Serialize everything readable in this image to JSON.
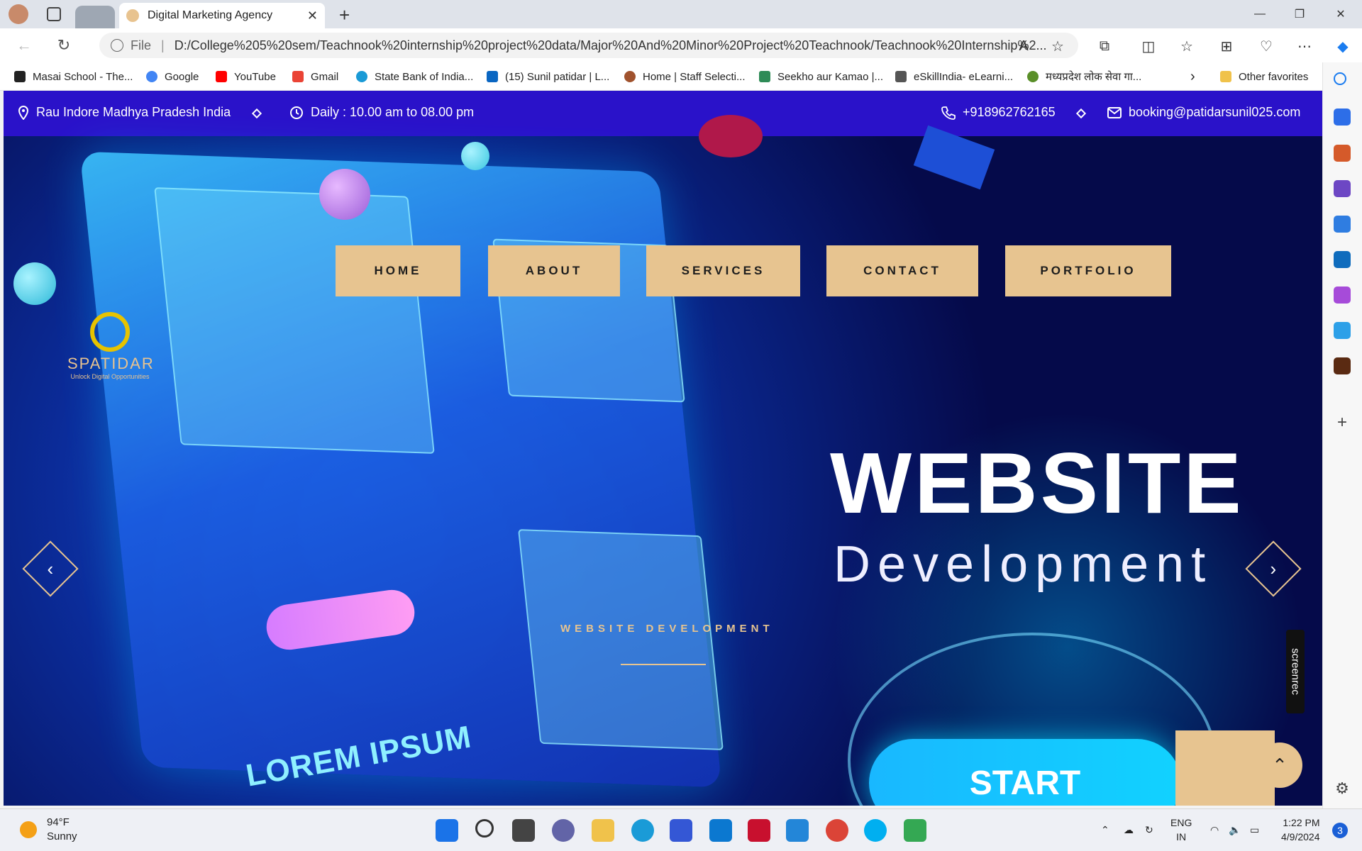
{
  "browser": {
    "tab_title": "Digital Marketing Agency",
    "address_prefix": "File",
    "url": "D:/College%205%20sem/Teachnook%20internship%20project%20data/Major%20And%20Minor%20Project%20Teachnook/Teachnook%20Internship%2...",
    "favorites": [
      {
        "label": "Masai School - The...",
        "icon": "masai-icon",
        "color": "#222222"
      },
      {
        "label": "Google",
        "icon": "google-icon",
        "color": "#4285f4"
      },
      {
        "label": "YouTube",
        "icon": "youtube-icon",
        "color": "#ff0000"
      },
      {
        "label": "Gmail",
        "icon": "gmail-icon",
        "color": "#ea4335"
      },
      {
        "label": "State Bank of India...",
        "icon": "sbi-icon",
        "color": "#1a9ad6"
      },
      {
        "label": "(15) Sunil patidar | L...",
        "icon": "linkedin-icon",
        "color": "#0a66c2"
      },
      {
        "label": "Home | Staff Selecti...",
        "icon": "ssc-icon",
        "color": "#a0522d"
      },
      {
        "label": "Seekho aur Kamao |...",
        "icon": "seekho-icon",
        "color": "#2e8b57"
      },
      {
        "label": "eSkillIndia- eLearni...",
        "icon": "eskill-icon",
        "color": "#555555"
      },
      {
        "label": "मध्यप्रदेश लोक सेवा गा...",
        "icon": "mp-icon",
        "color": "#5a8f29"
      }
    ],
    "other_favorites": "Other favorites"
  },
  "page": {
    "topbar": {
      "location": "Rau Indore Madhya Pradesh India",
      "hours": "Daily : 10.00 am to 08.00 pm",
      "phone": "+918962762165",
      "email": "booking@patidarsunil025.com"
    },
    "logo": {
      "name": "SPATIDAR",
      "tagline": "Unlock Digital Opportunities"
    },
    "nav": [
      "HOME",
      "ABOUT",
      "SERVICES",
      "CONTACT",
      "PORTFOLIO"
    ],
    "hero": {
      "headline": "WEBSITE",
      "subheadline": "Development",
      "caption": "WEBSITE DEVELOPMENT",
      "cta": "START",
      "art_text": "LOREM IPSUM",
      "prev": "‹",
      "next": "›"
    },
    "recorder": "screenrec",
    "back_to_top": "⌃"
  },
  "taskbar": {
    "temperature": "94°F",
    "condition": "Sunny",
    "lang": "ENG",
    "region": "IN",
    "time": "1:22 PM",
    "date": "4/9/2024",
    "notifications": "3"
  },
  "colors": {
    "accent": "#e7c490",
    "topbar": "#2a12c9",
    "cta": "#19b8ff"
  }
}
